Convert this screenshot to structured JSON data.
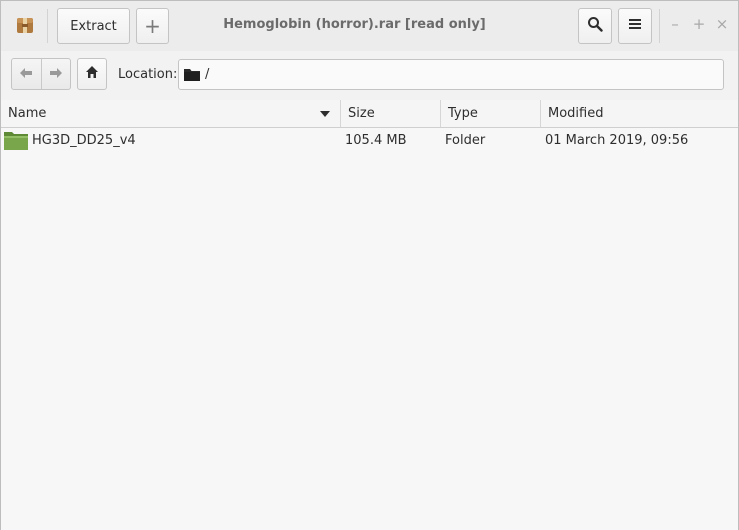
{
  "window": {
    "title": "Hemoglobin (horror).rar [read only]",
    "app_icon": "archive-manager-icon"
  },
  "headerbar": {
    "extract_label": "Extract",
    "add_label": "+",
    "search_icon": "search-icon",
    "menu_icon": "hamburger-menu-icon",
    "minimize_label": "–",
    "maximize_label": "+",
    "close_label": "×"
  },
  "toolbar": {
    "back_icon": "arrow-left-icon",
    "forward_icon": "arrow-right-icon",
    "home_icon": "home-icon",
    "location_label": "Location:",
    "location_path": "/"
  },
  "columns": {
    "name": "Name",
    "size": "Size",
    "type": "Type",
    "modified": "Modified"
  },
  "files": [
    {
      "name": "HG3D_DD25_v4",
      "size": "105.4 MB",
      "type": "Folder",
      "modified": "01 March 2019, 09:56",
      "icon": "folder-icon"
    }
  ],
  "colors": {
    "folder_green": "#7aa64b",
    "background": "#f7f7f7",
    "header_bg": "#ececec"
  }
}
